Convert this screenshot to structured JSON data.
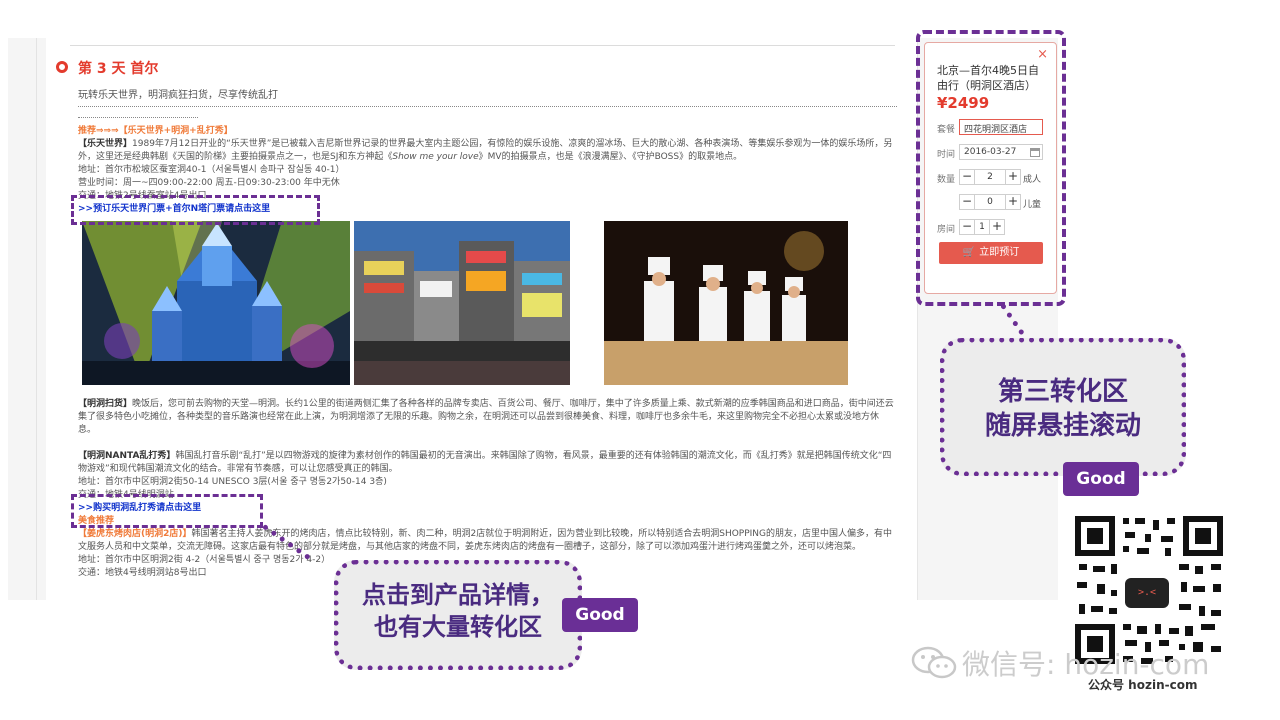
{
  "article": {
    "day_title": "第 3 天 首尔",
    "subtitle": "玩转乐天世界，明洞疯狂扫货，尽享传统乱打",
    "recommend_line": "推荐⇒⇒⇒【乐天世界+明洞+乱打秀】",
    "lotte": {
      "heading": "【乐天世界】",
      "text_a": "1989年7月12日开业的“乐天世界”是已被载入吉尼斯世界记录的世界最大室内主题公园，有惊险的娱乐设施、凉爽的溜冰场、巨大的散心湖、各种表演场、等集娱乐参观为一体的娱乐场所，另外，这里还是经典韩剧《天国的阶梯》主要拍摄景点之一，也是SJ和东方神起《",
      "song": "Show me your love",
      "text_b": "》MV的拍摄景点，也是《浪漫满屋》、《守护BOSS》的取景地点。",
      "address": "地址：首尔市松坡区蚕室洞40-1（서울특별시 송파구 잠실동 40-1）",
      "hours": "营业时间：周一~四09:00-22:00 周五-日09:30-23:00 年中无休",
      "transport": "交通：地铁2号线蚕室站4号出口",
      "link": ">>预订乐天世界门票+首尔N塔门票请点击这里"
    },
    "myeongdong": {
      "heading": "【明洞扫货】",
      "text": "晚饭后，您可前去购物的天堂—明洞。长约1公里的街道两侧汇集了各种各样的品牌专卖店、百货公司、餐厅、咖啡厅，集中了许多质量上乘、款式新潮的应季韩国商品和进口商品，街中间还云集了很多特色小吃摊位，各种类型的音乐路演也经常在此上演，为明洞增添了无限的乐趣。购物之余，在明洞还可以品尝到很棒美食、料理，咖啡厅也多余牛毛，来这里购物完全不必担心太累或没地方休息。"
    },
    "nanta": {
      "heading": "【明洞NANTA乱打秀】",
      "text": "韩国乱打音乐剧“乱打”是以四物游戏的旋律为素材创作的韩国最初的无音演出。来韩国除了购物，看风景，最重要的还有体验韩国的潮流文化，而《乱打秀》就是把韩国传统文化“四物游戏”和现代韩国潮流文化的结合。非常有节奏感，可以让您感受真正的韩国。",
      "address": "地址：首尔市中区明洞2街50-14 UNESCO 3层(서울 중구 명동2가50-14 3층)",
      "transport": "交通：地铁4号线明洞站",
      "link": ">>购买明洞乱打秀请点击这里",
      "food_label": "美食推荐"
    },
    "bbq": {
      "heading": "【姜虎东烤肉店(明洞2店)】",
      "text": "韩国著名主持人姜虎东开的烤肉店，情点比较特别，新、肉二种，明洞2店就位于明洞附近，因为营业到比较晚，所以特别适合去明洞SHOPPING的朋友，店里中国人偏多，有中文服务人员和中文菜单，交流无障碍。这家店最有特色的部分就是烤盘，与其他店家的烤盘不同，姜虎东烤肉店的烤盘有一圈槽子，这部分，除了可以添加鸡蛋汁进行烤鸡蛋羹之外，还可以烤泡菜。",
      "address": "地址：首尔市中区明洞2街 4-2（서울특별시 중구 명동2가 4-2）",
      "transport": "交通：地铁4号线明洞站8号出口"
    }
  },
  "booking": {
    "close_icon": "×",
    "product_title": "北京—首尔4晚5日自由行（明洞区酒店）",
    "price": "¥2499",
    "package_label": "套餐",
    "package_value": "四花明洞区酒店",
    "date_label": "时间",
    "date_value": "2016-03-27",
    "qty_label": "数量",
    "adult_value": "2",
    "adult_unit": "成人",
    "child_value": "0",
    "child_unit": "儿童",
    "room_label": "房间",
    "room_value": "1",
    "minus": "−",
    "plus": "+",
    "book_button": "立即预订"
  },
  "annotations": {
    "callout_right_line1": "第三转化区",
    "callout_right_line2": "随屏悬挂滚动",
    "callout_left_line1": "点击到产品详情，",
    "callout_left_line2": "也有大量转化区",
    "good": "Good",
    "accent_color": "#6b2f94"
  },
  "watermark": {
    "main": "微信号: hozin-com",
    "sub": "公众号 hozin-com"
  }
}
